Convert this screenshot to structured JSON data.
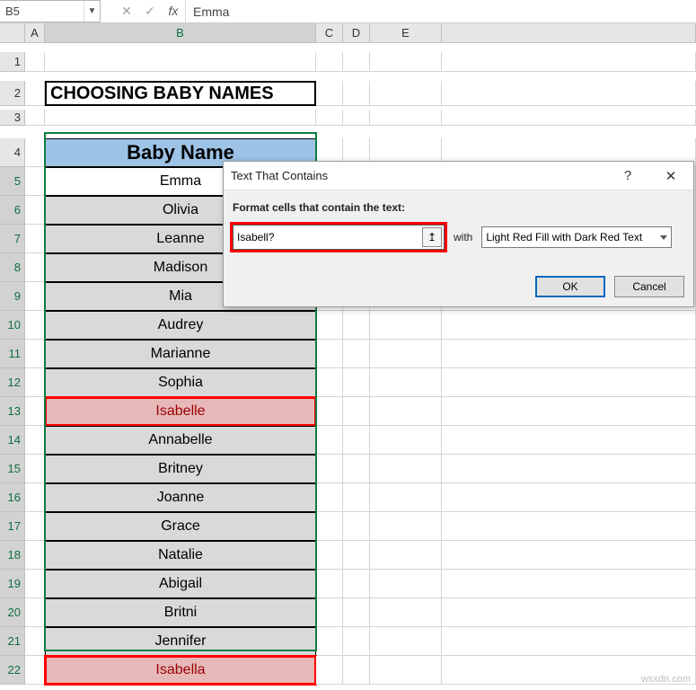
{
  "formula_bar": {
    "name_box": "B5",
    "cancel_icon": "✕",
    "confirm_icon": "✓",
    "fx": "fx",
    "formula": "Emma"
  },
  "columns": [
    "",
    "A",
    "B",
    "C",
    "D",
    "E",
    ""
  ],
  "rows": [
    "1",
    "2",
    "3",
    "4",
    "5",
    "6",
    "7",
    "8",
    "9",
    "10",
    "11",
    "12",
    "13",
    "14",
    "15",
    "16",
    "17",
    "18",
    "19",
    "20",
    "21",
    "22"
  ],
  "title": "CHOOSING BABY NAMES",
  "table": {
    "header": "Baby Name",
    "items": [
      {
        "name": "Emma",
        "highlight": false,
        "redbox": false,
        "active": true
      },
      {
        "name": "Olivia",
        "highlight": false,
        "redbox": false
      },
      {
        "name": "Leanne",
        "highlight": false,
        "redbox": false
      },
      {
        "name": "Madison",
        "highlight": false,
        "redbox": false
      },
      {
        "name": "Mia",
        "highlight": false,
        "redbox": false
      },
      {
        "name": "Audrey",
        "highlight": false,
        "redbox": false
      },
      {
        "name": "Marianne",
        "highlight": false,
        "redbox": false
      },
      {
        "name": "Sophia",
        "highlight": false,
        "redbox": false
      },
      {
        "name": "Isabelle",
        "highlight": true,
        "redbox": true
      },
      {
        "name": "Annabelle",
        "highlight": false,
        "redbox": false
      },
      {
        "name": "Britney",
        "highlight": false,
        "redbox": false
      },
      {
        "name": "Joanne",
        "highlight": false,
        "redbox": false
      },
      {
        "name": "Grace",
        "highlight": false,
        "redbox": false
      },
      {
        "name": "Natalie",
        "highlight": false,
        "redbox": false
      },
      {
        "name": "Abigail",
        "highlight": false,
        "redbox": false
      },
      {
        "name": "Britni",
        "highlight": false,
        "redbox": false
      },
      {
        "name": "Jennifer",
        "highlight": false,
        "redbox": false
      },
      {
        "name": "Isabella",
        "highlight": true,
        "redbox": true
      }
    ]
  },
  "dialog": {
    "title": "Text That Contains",
    "help_icon": "?",
    "close_icon": "✕",
    "label": "Format cells that contain the text:",
    "input_value": "Isabell?",
    "collapse_icon": "↥",
    "with_label": "with",
    "format_option": "Light Red Fill with Dark Red Text",
    "ok": "OK",
    "cancel": "Cancel"
  },
  "watermark": "wsxdn.com"
}
